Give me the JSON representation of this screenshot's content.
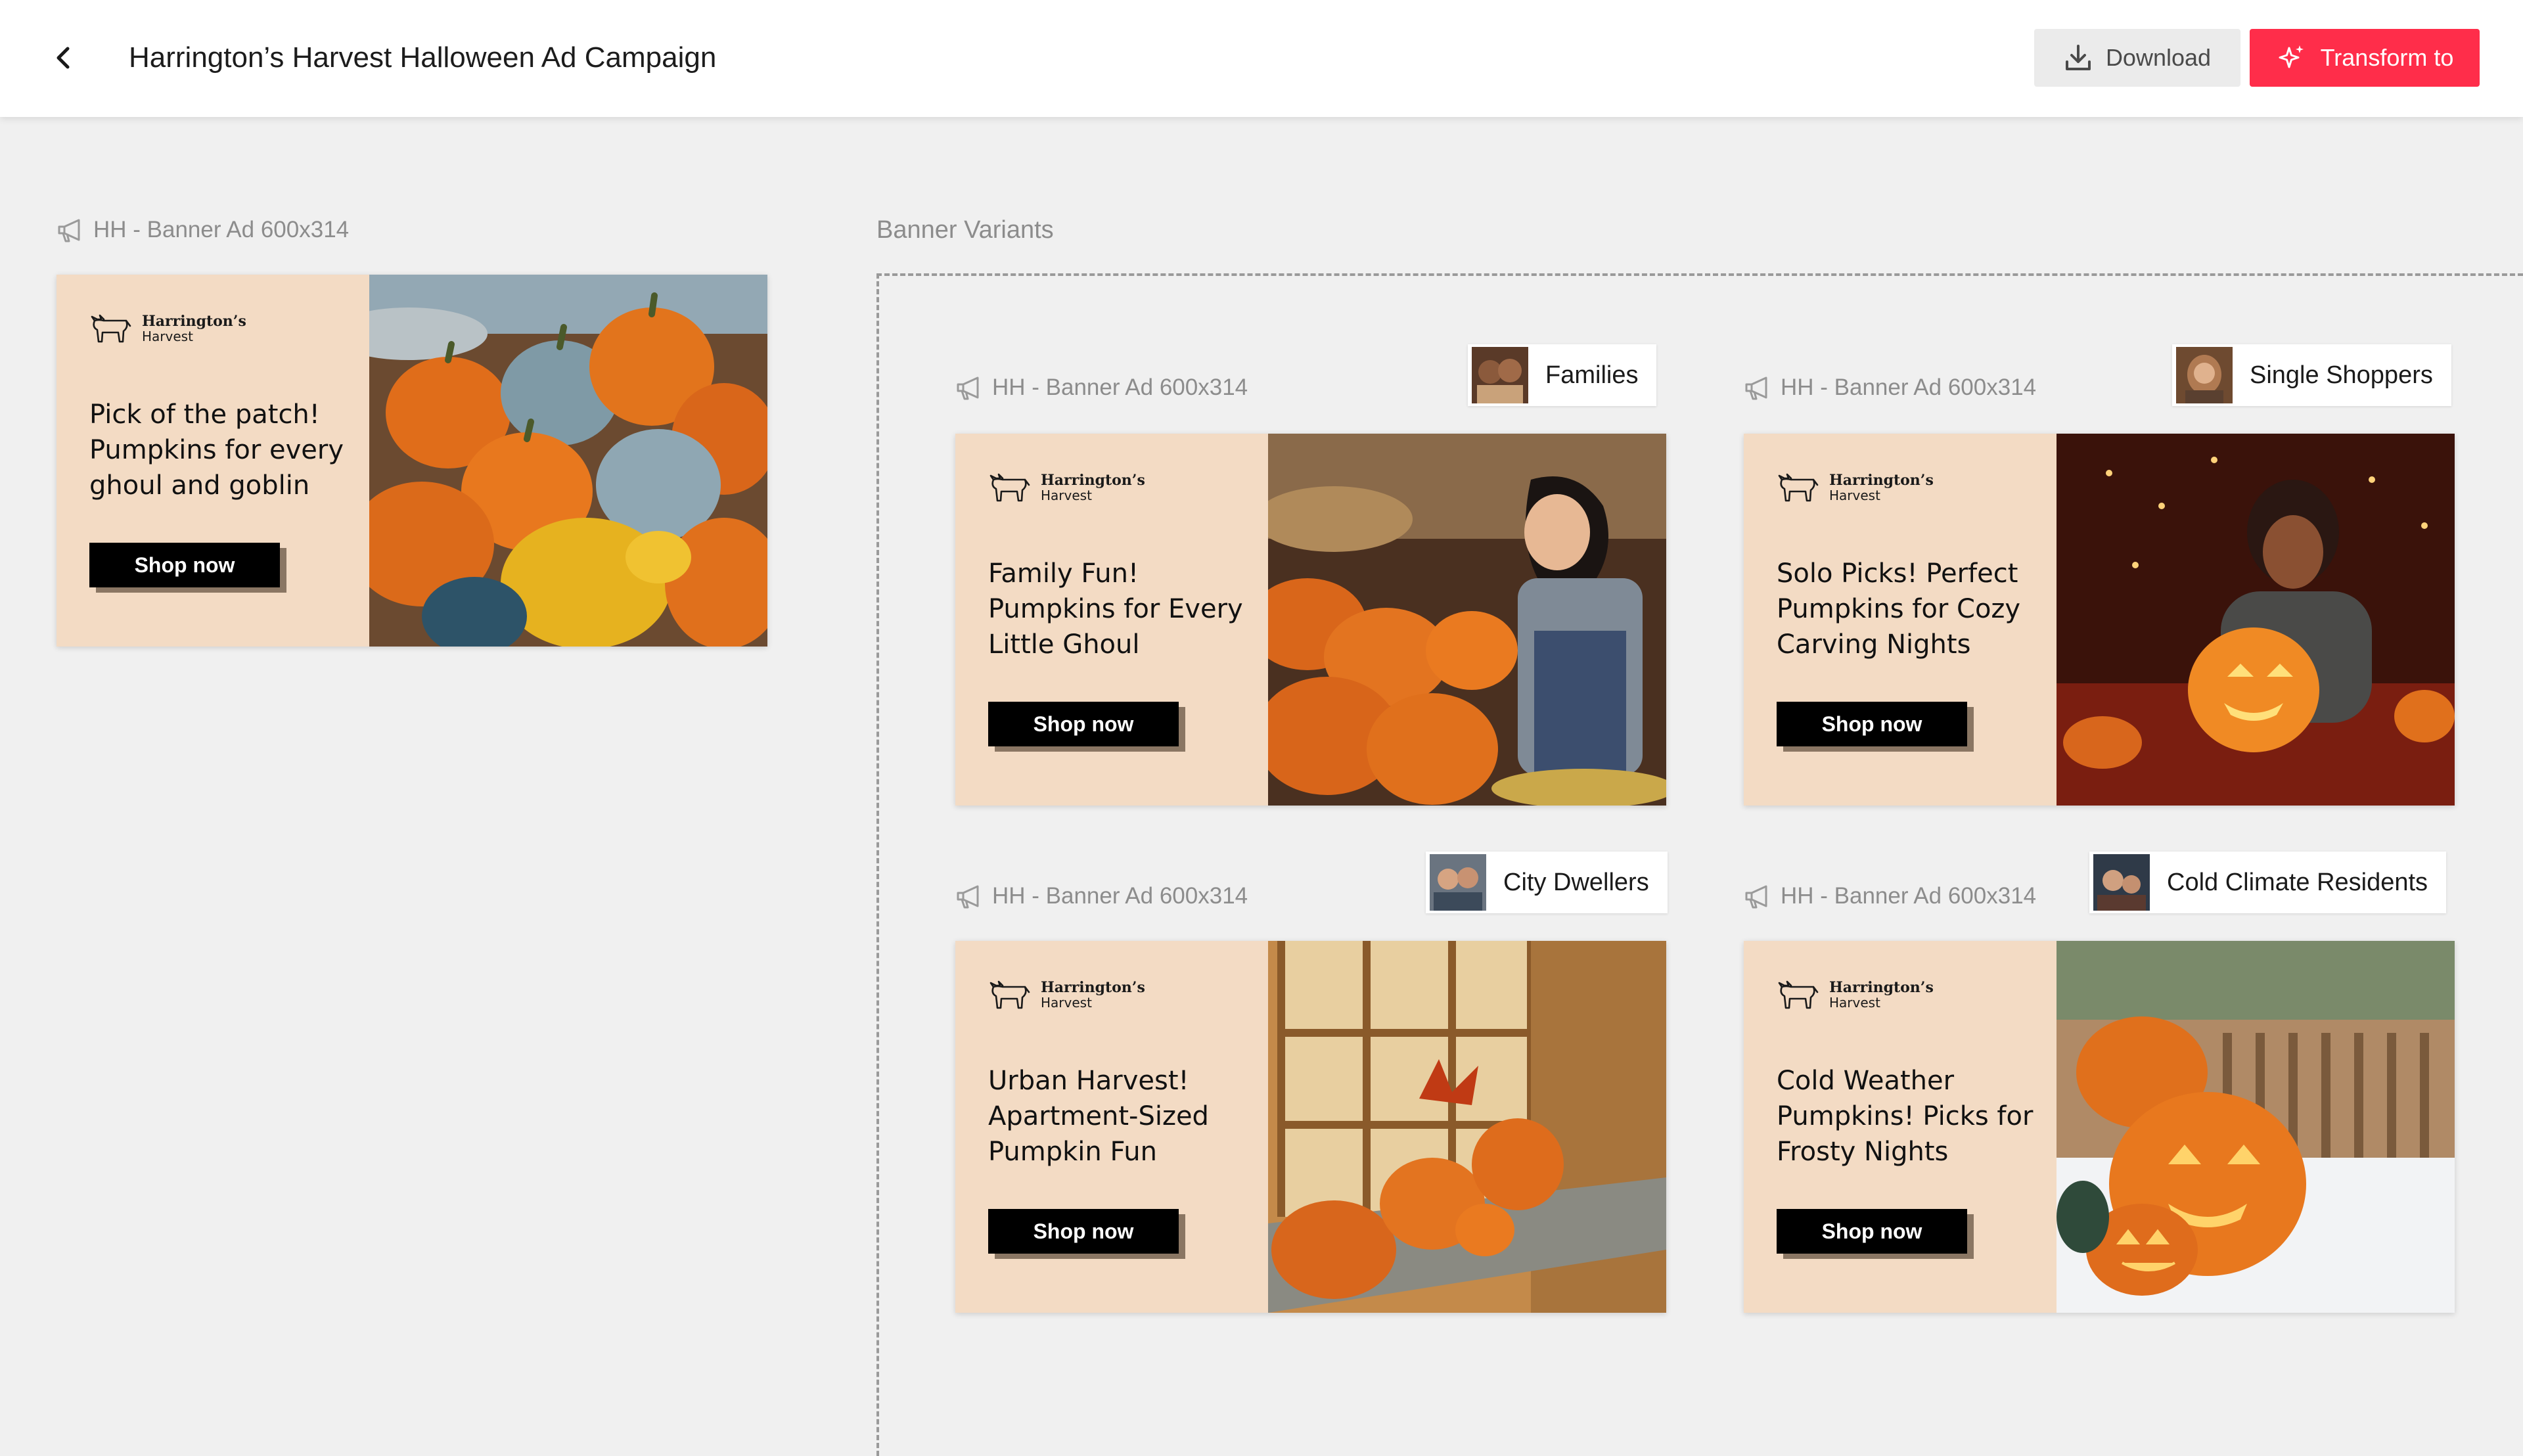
{
  "header": {
    "title": "Harrington’s Harvest Halloween Ad Campaign",
    "download_label": "Download",
    "transform_label": "Transform to",
    "accent_color": "#ff2d4a",
    "back_icon": "chevron-left-icon",
    "download_icon": "download-icon",
    "transform_icon": "sparkle-icon"
  },
  "original": {
    "label": "HH - Banner Ad 600x314",
    "brand_name": "Harrington’s",
    "brand_sub": "Harvest",
    "headline": "Pick of the patch! Pumpkins for every ghoul and goblin",
    "cta": "Shop now"
  },
  "variants_section": {
    "label": "Banner Variants",
    "items": [
      {
        "label": "HH - Banner Ad 600x314",
        "audience": "Families",
        "brand_name": "Harrington’s",
        "brand_sub": "Harvest",
        "headline": "Family Fun! Pumpkins for Every Little Ghoul",
        "cta": "Shop now"
      },
      {
        "label": "HH - Banner Ad 600x314",
        "audience": "Single Shoppers",
        "brand_name": "Harrington’s",
        "brand_sub": "Harvest",
        "headline": "Solo Picks! Perfect Pumpkins for Cozy Carving Nights",
        "cta": "Shop now"
      },
      {
        "label": "HH - Banner Ad 600x314",
        "audience": "City Dwellers",
        "brand_name": "Harrington’s",
        "brand_sub": "Harvest",
        "headline": "Urban Harvest! Apartment-Sized Pumpkin Fun",
        "cta": "Shop now"
      },
      {
        "label": "HH - Banner Ad 600x314",
        "audience": "Cold Climate Residents",
        "brand_name": "Harrington’s",
        "brand_sub": "Harvest",
        "headline": "Cold Weather Pumpkins! Picks for Frosty Nights",
        "cta": "Shop now"
      }
    ]
  }
}
